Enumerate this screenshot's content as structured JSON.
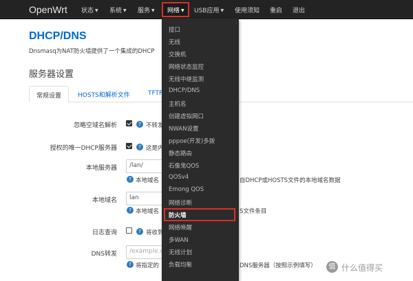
{
  "navbar": {
    "brand": "OpenWrt",
    "items": [
      {
        "label": "状态"
      },
      {
        "label": "系统"
      },
      {
        "label": "服务"
      },
      {
        "label": "网络"
      },
      {
        "label": "USB应用"
      },
      {
        "label": "使用须知"
      },
      {
        "label": "重启"
      },
      {
        "label": "退出"
      }
    ]
  },
  "page": {
    "title": "DHCP/DNS",
    "description": "Dnsmasq为NAT防火墙提供了一个集成的DHCP",
    "section_title": "服务器设置"
  },
  "tabs": [
    {
      "label": "常规设置",
      "active": true
    },
    {
      "label": "HOSTS和解析文件",
      "active": false
    },
    {
      "label": "TFTP",
      "active": false
    }
  ],
  "form": {
    "ignore_empty_domain": {
      "label": "忽略空域名解析",
      "checked": true,
      "help": "不转发"
    },
    "authoritative": {
      "label": "授权的唯一DHCP服务器",
      "checked": true,
      "help": "这是内"
    },
    "local_server": {
      "label": "本地服务器",
      "value": "/lan/",
      "help_left": "本地域名",
      "help_right": "自DHCP或HOSTS文件的本地域名数据"
    },
    "local_domain": {
      "label": "本地域名",
      "value": "lan",
      "help_left": "本地域名",
      "help_right": "S文件条目"
    },
    "log_queries": {
      "label": "日志查询",
      "checked": false,
      "help": "将收到"
    },
    "dns_forward": {
      "label": "DNS转发",
      "placeholder": "/example.or",
      "help_left": "将指定的",
      "help_right": "DNS服务器（按照示例填写）"
    }
  },
  "network_menu": {
    "items": [
      "接口",
      "无线",
      "交换机",
      "网络状态监控",
      "无线中继监测",
      "DHCP/DNS",
      "主机名",
      "创建虚拟网口",
      "NWAN设置",
      "pppoe(开发)多拨",
      "静态路由",
      "石像鬼QOS",
      "QOSv4",
      "Emong QOS",
      "网络诊断",
      "防火墙",
      "网络唤醒",
      "多WAN",
      "无线计划",
      "负载均衡"
    ],
    "selected": "防火墙"
  },
  "watermark": {
    "badge": "值",
    "text": "什么值得买"
  },
  "colors": {
    "navbar_bg": "#232323",
    "dropdown_bg": "#2b2b2b",
    "highlight_red": "#d9302a",
    "title_blue": "#0069d6"
  },
  "icons": {
    "help": "help-circle-icon",
    "caret": "caret-down-icon"
  }
}
